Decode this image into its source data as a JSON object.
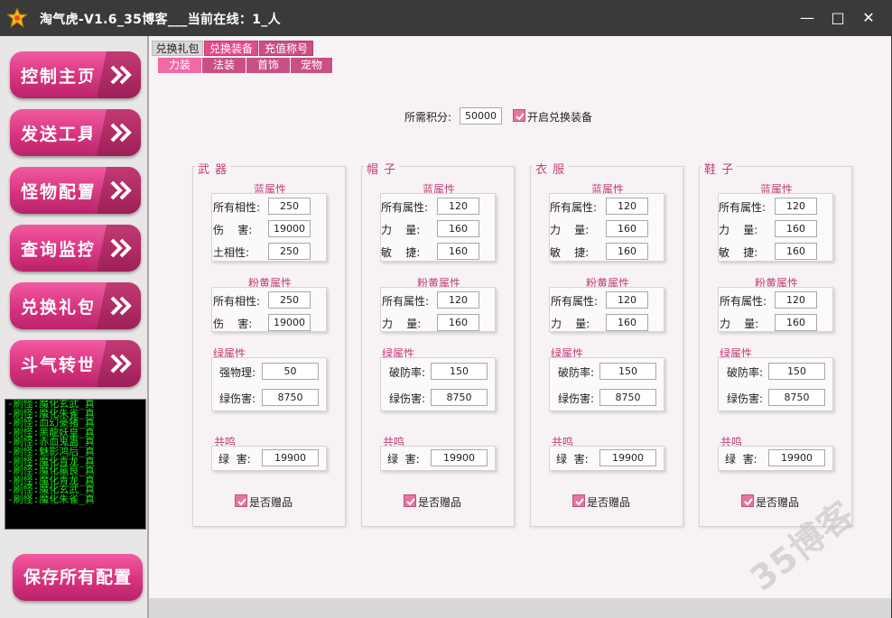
{
  "window": {
    "title": "淘气虎-V1.6_35博客___当前在线：1_人",
    "minimize": "—",
    "maximize": "□",
    "close": "✕"
  },
  "sidebar": {
    "items": [
      {
        "label": "控制主页"
      },
      {
        "label": "发送工具"
      },
      {
        "label": "怪物配置"
      },
      {
        "label": "查询监控"
      },
      {
        "label": "兑换礼包"
      },
      {
        "label": "斗气转世"
      }
    ],
    "log_lines": [
      "-刷怪:魔化玄武_真",
      "-刷怪:魔化朱雀_真",
      "-刷怪:血幻豪猪_真",
      "-刷怪:黑龍妖皇_真",
      "-刷怪:赤血鬼蛊_真",
      "-刷怪:魅影鸿后_真",
      "-刷怪:魔化青龙_真",
      "-刷怪:魔化蠃良_真",
      "-刷怪:魔化青龙_真",
      "-刷怪:魔化玄武_真",
      "-刷怪:魔化朱雀_真"
    ],
    "save_label": "保存所有配置"
  },
  "tabs": {
    "top": [
      "兑换礼包",
      "兑换装备",
      "充值称号"
    ],
    "sub": [
      "力装",
      "法装",
      "首饰",
      "宠物"
    ]
  },
  "header": {
    "points_label": "所需积分:",
    "points_value": "50000",
    "enable_label": "开启兑换装备"
  },
  "groups": [
    {
      "title": "武 器",
      "blue_title": "蓝属性",
      "blue": [
        {
          "label": "所有相性:",
          "value": "250"
        },
        {
          "label": "伤    害:",
          "value": "19000"
        },
        {
          "label": "土相性:",
          "value": "250"
        }
      ],
      "pink_title": "粉黄属性",
      "pink": [
        {
          "label": "所有相性:",
          "value": "250"
        },
        {
          "label": "伤    害:",
          "value": "19000"
        }
      ],
      "green_title": "绿属性",
      "green": [
        {
          "label": "强物理:",
          "value": "50"
        },
        {
          "label": "绿伤害:",
          "value": "8750"
        }
      ],
      "resonance_title": "共鸣",
      "resonance": {
        "label": "绿  害:",
        "value": "19900"
      },
      "gift_label": "是否赠品"
    },
    {
      "title": "帽 子",
      "blue_title": "蓝属性",
      "blue": [
        {
          "label": "所有属性:",
          "value": "120"
        },
        {
          "label": "力    量:",
          "value": "160"
        },
        {
          "label": "敏    捷:",
          "value": "160"
        }
      ],
      "pink_title": "粉黄属性",
      "pink": [
        {
          "label": "所有属性:",
          "value": "120"
        },
        {
          "label": "力    量:",
          "value": "160"
        }
      ],
      "green_title": "绿属性",
      "green": [
        {
          "label": "破防率:",
          "value": "150"
        },
        {
          "label": "绿伤害:",
          "value": "8750"
        }
      ],
      "resonance_title": "共鸣",
      "resonance": {
        "label": "绿  害:",
        "value": "19900"
      },
      "gift_label": "是否赠品"
    },
    {
      "title": "衣 服",
      "blue_title": "蓝属性",
      "blue": [
        {
          "label": "所有属性:",
          "value": "120"
        },
        {
          "label": "力    量:",
          "value": "160"
        },
        {
          "label": "敏    捷:",
          "value": "160"
        }
      ],
      "pink_title": "粉黄属性",
      "pink": [
        {
          "label": "所有属性:",
          "value": "120"
        },
        {
          "label": "力    量:",
          "value": "160"
        }
      ],
      "green_title": "绿属性",
      "green": [
        {
          "label": "破防率:",
          "value": "150"
        },
        {
          "label": "绿伤害:",
          "value": "8750"
        }
      ],
      "resonance_title": "共鸣",
      "resonance": {
        "label": "绿  害:",
        "value": "19900"
      },
      "gift_label": "是否赠品"
    },
    {
      "title": "鞋 子",
      "blue_title": "蓝属性",
      "blue": [
        {
          "label": "所有属性:",
          "value": "120"
        },
        {
          "label": "力    量:",
          "value": "160"
        },
        {
          "label": "敏    捷:",
          "value": "160"
        }
      ],
      "pink_title": "粉黄属性",
      "pink": [
        {
          "label": "所有属性:",
          "value": "120"
        },
        {
          "label": "力    量:",
          "value": "160"
        }
      ],
      "green_title": "绿属性",
      "green": [
        {
          "label": "破防率:",
          "value": "150"
        },
        {
          "label": "绿伤害:",
          "value": "8750"
        }
      ],
      "resonance_title": "共鸣",
      "resonance": {
        "label": "绿  害:",
        "value": "19900"
      },
      "gift_label": "是否赠品"
    }
  ],
  "watermark": "35博客",
  "colors": {
    "accent": "#d8337f",
    "titlebar": "#3a3a3a",
    "log_text": "#19e619"
  }
}
